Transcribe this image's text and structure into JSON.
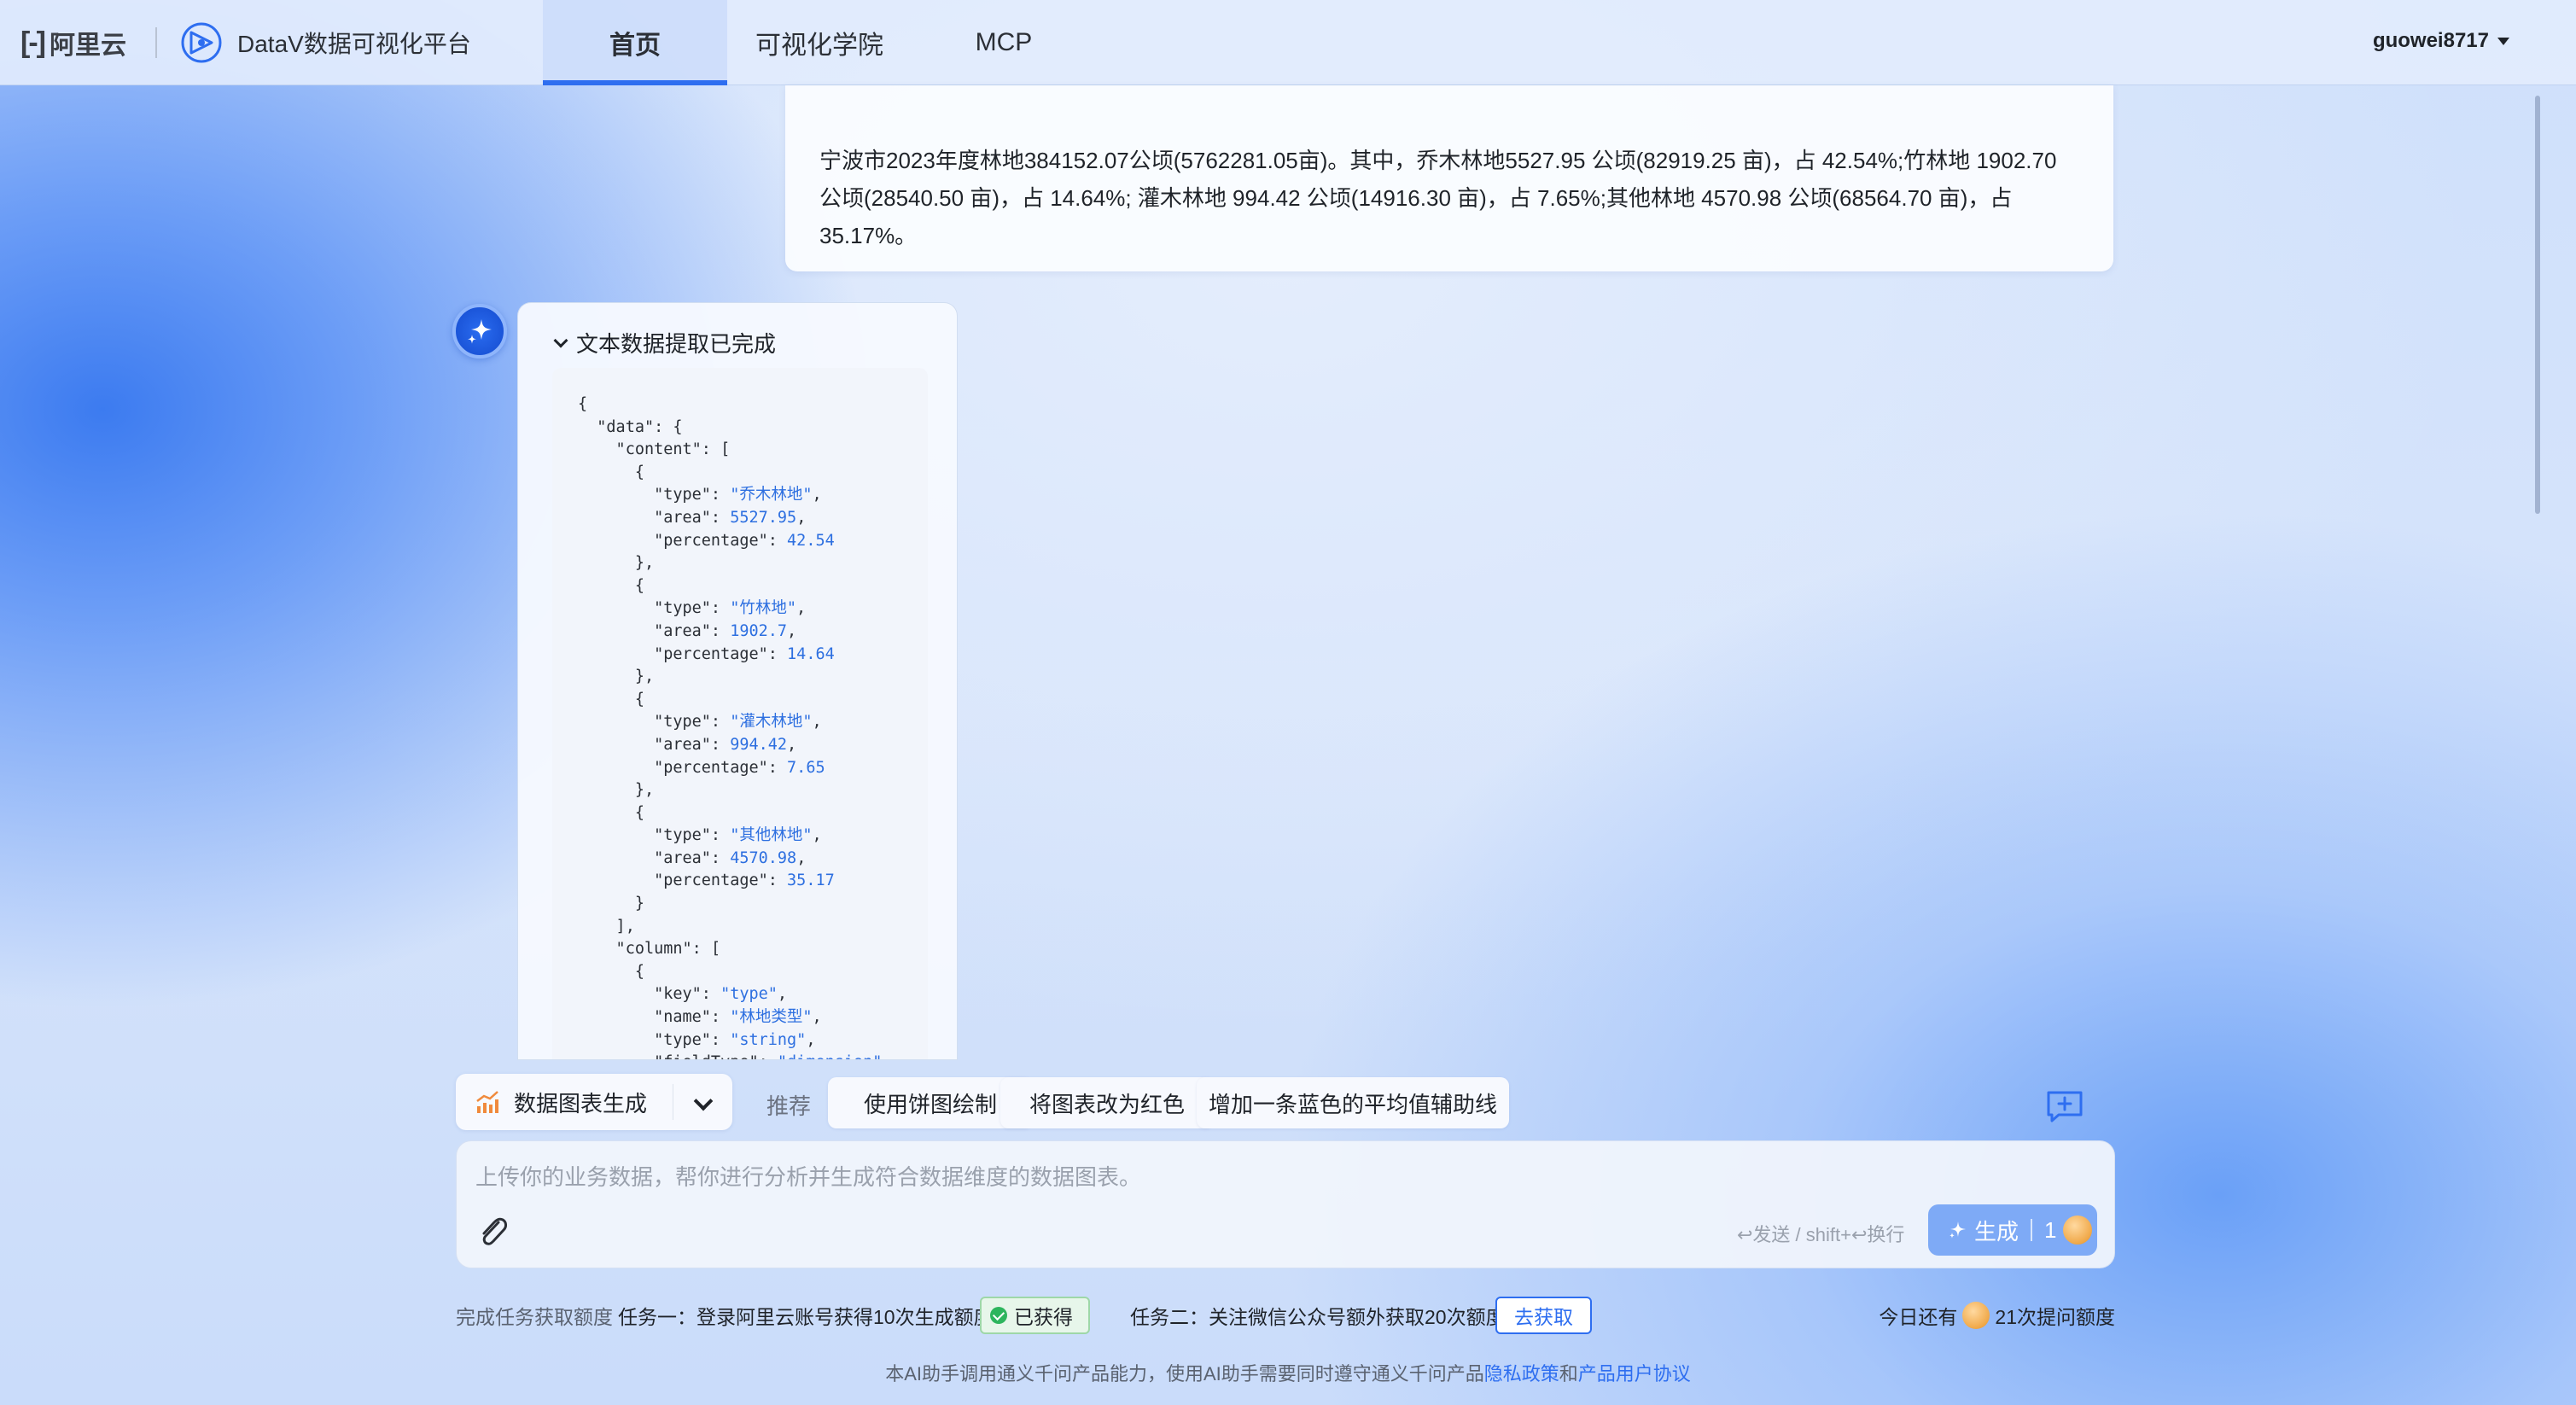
{
  "nav": {
    "aliyun_logo_text": "阿里云",
    "product_title": "DataV数据可视化平台",
    "tabs": [
      {
        "label": "首页",
        "active": true
      },
      {
        "label": "可视化学院",
        "active": false
      },
      {
        "label": "MCP",
        "active": false
      }
    ],
    "username": "guowei8717",
    "accent_color": "#2e6ef0"
  },
  "conversation": {
    "user_message": "宁波市2023年度林地384152.07公顷(5762281.05亩)。其中，乔木林地5527.95 公顷(82919.25 亩)，占 42.54%;竹林地 1902.70 公顷(28540.50 亩)，占 14.64%; 灌木林地 994.42 公顷(14916.30 亩)，占 7.65%;其他林地 4570.98 公顷(68564.70 亩)，占 35.17%。",
    "assistant": {
      "status_title": "文本数据提取已完成",
      "code_lines": [
        "{",
        "  \"data\": {",
        "    \"content\": [",
        "      {",
        "        \"type\": \"乔木林地\",",
        "        \"area\": 5527.95,",
        "        \"percentage\": 42.54",
        "      },",
        "      {",
        "        \"type\": \"竹林地\",",
        "        \"area\": 1902.7,",
        "        \"percentage\": 14.64",
        "      },",
        "      {",
        "        \"type\": \"灌木林地\",",
        "        \"area\": 994.42,",
        "        \"percentage\": 7.65",
        "      },",
        "      {",
        "        \"type\": \"其他林地\",",
        "        \"area\": 4570.98,",
        "        \"percentage\": 35.17",
        "      }",
        "    ],",
        "    \"column\": [",
        "      {",
        "        \"key\": \"type\",",
        "        \"name\": \"林地类型\",",
        "        \"type\": \"string\",",
        "        \"fieldType\": \"dimension\""
      ]
    }
  },
  "composer": {
    "mode_label": "数据图表生成",
    "recommend_label": "推荐",
    "suggestions": [
      "使用饼图绘制",
      "将图表改为红色",
      "增加一条蓝色的平均值辅助线"
    ],
    "placeholder": "上传你的业务数据，帮你进行分析并生成符合数据维度的数据图表。",
    "send_hint": "↩发送 / shift+↩换行",
    "generate_label": "生成",
    "generate_cost": "1"
  },
  "tasks": {
    "intro": "完成任务获取额度",
    "task1_text": "任务一：登录阿里云账号获得10次生成额度",
    "task1_badge": "已获得",
    "task2_text": "任务二：关注微信公众号额外获取20次额度",
    "task2_button": "去获取",
    "remaining_prefix": "今日还有",
    "remaining_suffix": "21次提问额度"
  },
  "footer": {
    "note_prefix": "本AI助手调用通义千问产品能力，使用AI助手需要同时遵守通义千问产品",
    "privacy_link": "隐私政策",
    "and": "和",
    "agreement_link": "产品用户协议"
  }
}
